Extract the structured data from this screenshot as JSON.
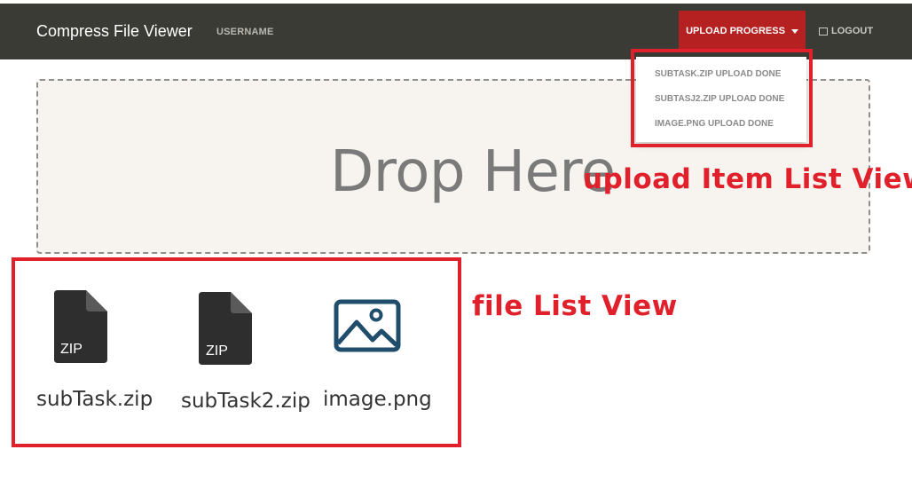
{
  "navbar": {
    "brand": "Compress File Viewer",
    "username": "USERNAME",
    "upload_progress_label": "UPLOAD PROGRESS",
    "logout_label": "LOGOUT"
  },
  "upload_dropdown": {
    "items": [
      "SUBTASK.ZIP UPLOAD DONE",
      "SUBTASJ2.ZIP UPLOAD DONE",
      "IMAGE.PNG UPLOAD DONE"
    ]
  },
  "dropzone": {
    "text": "Drop Here"
  },
  "annotations": {
    "upload_list": "upload Item List View",
    "file_list": "file List View"
  },
  "files": [
    {
      "name": "subTask.zip",
      "type": "zip",
      "badge": "ZIP",
      "icon": "zip-file-icon"
    },
    {
      "name": "subTask2.zip",
      "type": "zip",
      "badge": "ZIP",
      "icon": "zip-file-icon"
    },
    {
      "name": "image.png",
      "type": "image",
      "icon": "image-file-icon"
    }
  ],
  "colors": {
    "navbar_bg": "#3b3b36",
    "accent_red": "#b52020",
    "annotation_red": "#e0202a",
    "dropzone_bg": "#f7f4ef",
    "image_icon": "#1f4d6b"
  }
}
